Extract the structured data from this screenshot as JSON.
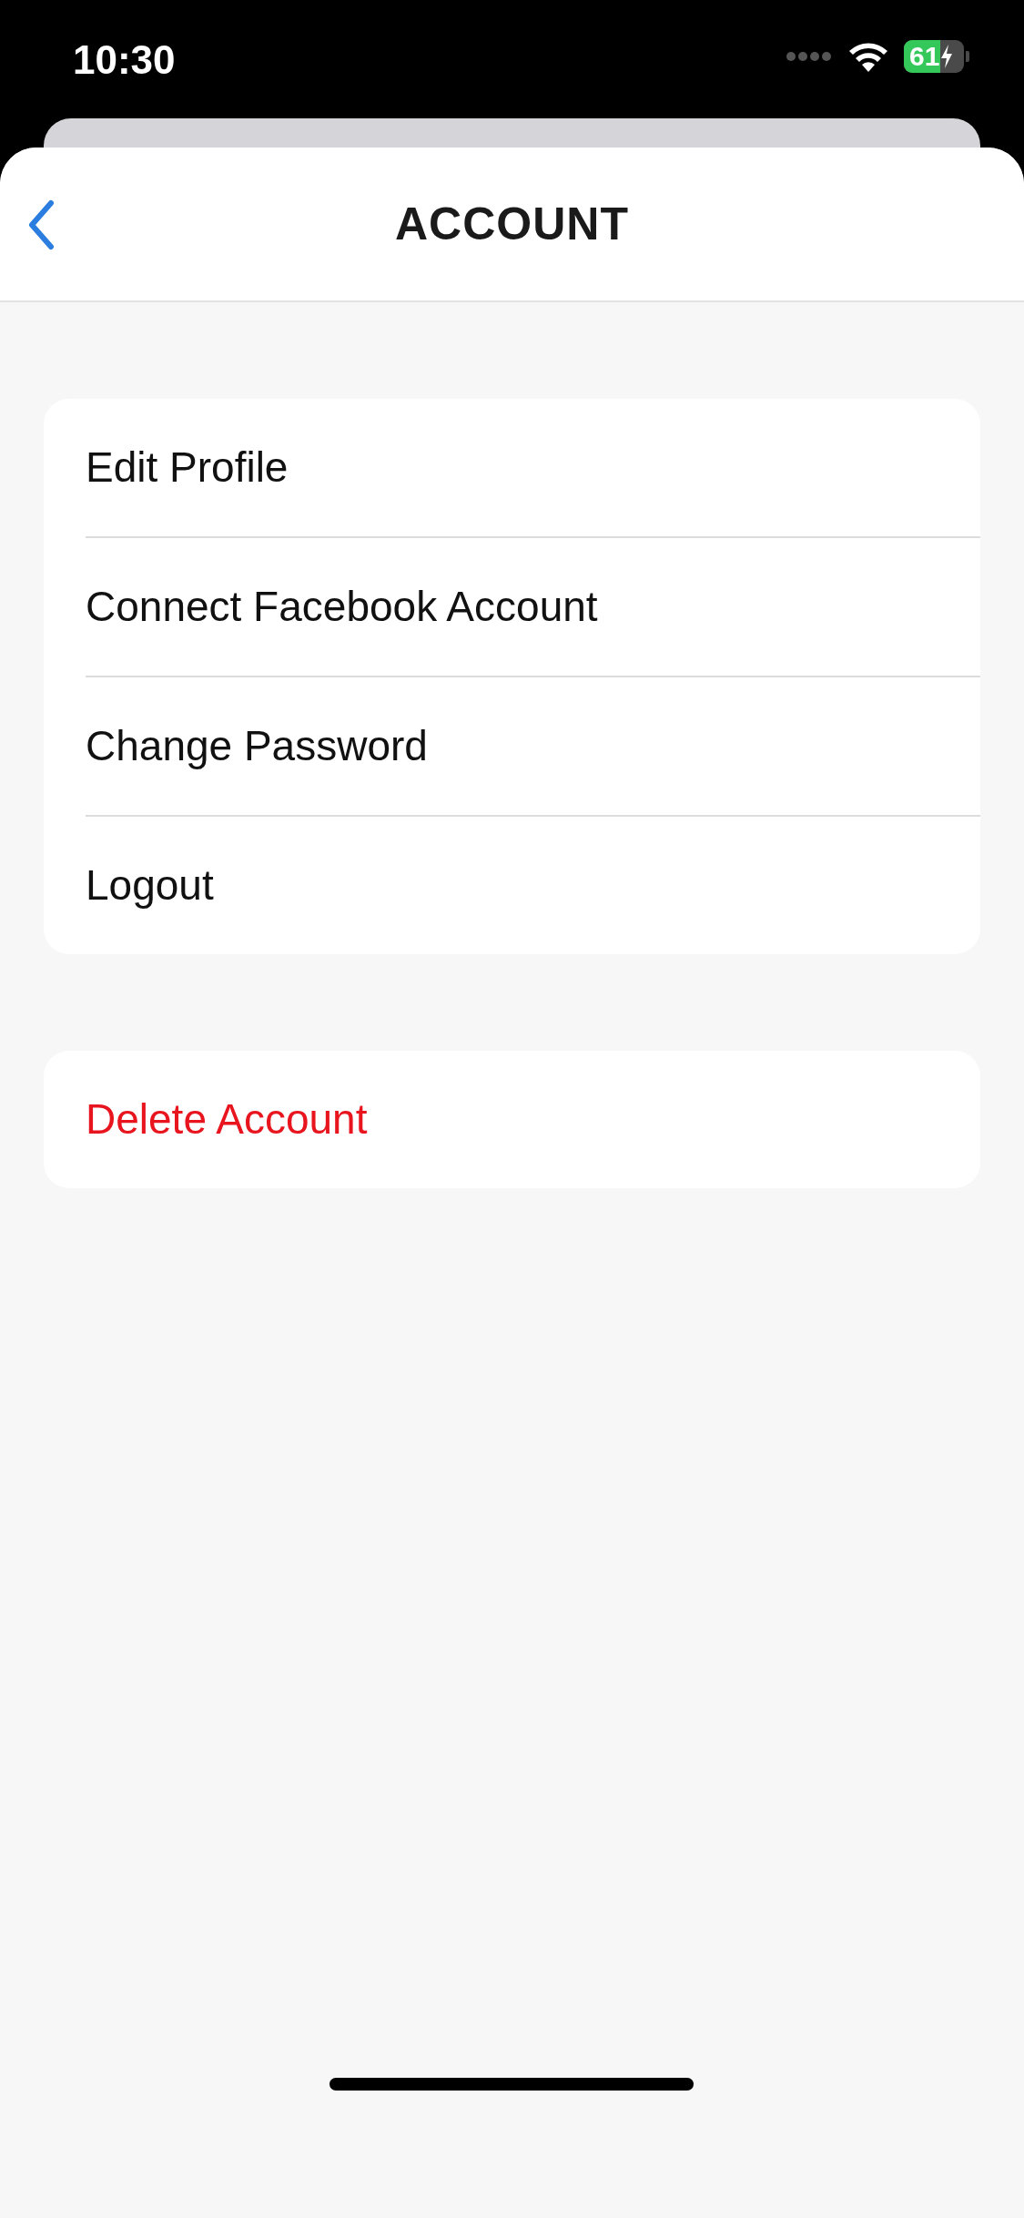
{
  "status_bar": {
    "time": "10:30",
    "battery": "61"
  },
  "header": {
    "title": "ACCOUNT"
  },
  "groups": [
    {
      "items": [
        {
          "label": "Edit Profile",
          "kind": "normal"
        },
        {
          "label": "Connect Facebook Account",
          "kind": "normal"
        },
        {
          "label": "Change Password",
          "kind": "normal"
        },
        {
          "label": "Logout",
          "kind": "normal"
        }
      ]
    },
    {
      "items": [
        {
          "label": "Delete Account",
          "kind": "destructive"
        }
      ]
    }
  ]
}
